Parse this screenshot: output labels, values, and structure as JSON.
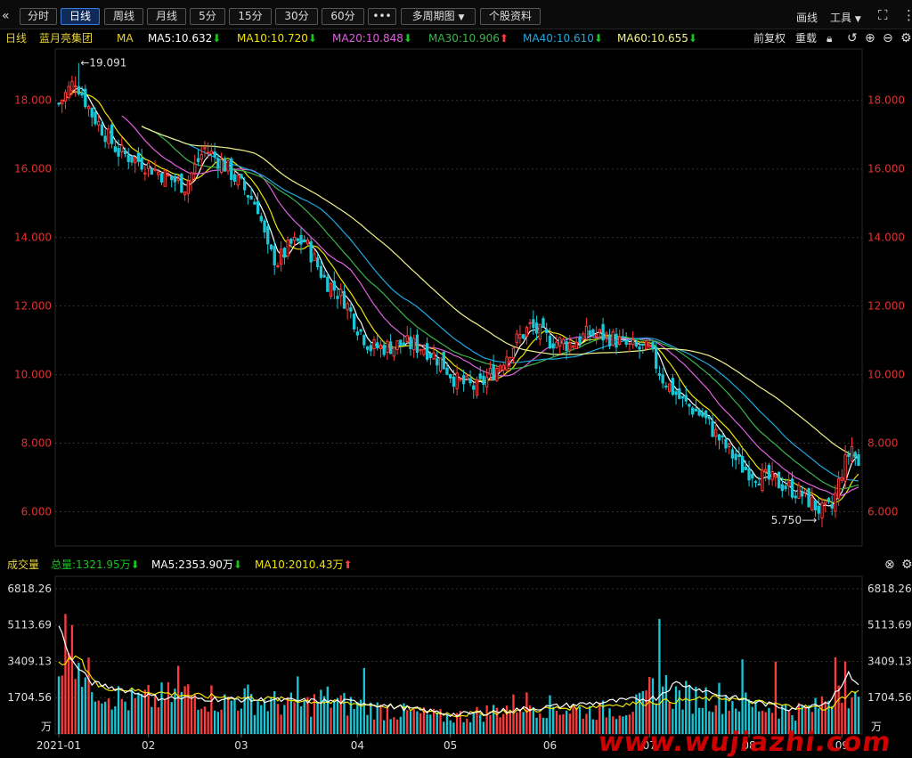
{
  "toolbar": {
    "collapse_icon": "double-chevron-left-icon",
    "tabs": [
      "分时",
      "日线",
      "周线",
      "月线",
      "5分",
      "15分",
      "30分",
      "60分"
    ],
    "active_tab": "日线",
    "more_label": "•••",
    "multi_period": "多周期图",
    "stock_info": "个股资料",
    "draw": "画线",
    "tools": "工具",
    "fullscreen_icon": "fullscreen-icon",
    "more_icon": "vertical-dots-icon"
  },
  "ma_bar": {
    "period": "日线",
    "stock_name": "蓝月亮集团",
    "ma_label": "MA",
    "items": [
      {
        "text": "MA5:10.632",
        "dir": "down",
        "color": "#ffffff"
      },
      {
        "text": "MA10:10.720",
        "dir": "down",
        "color": "#f2e600"
      },
      {
        "text": "MA20:10.848",
        "dir": "down",
        "color": "#e060e0"
      },
      {
        "text": "MA30:10.906",
        "dir": "up",
        "color": "#3bb54a"
      },
      {
        "text": "MA40:10.610",
        "dir": "down",
        "color": "#1fa8e0"
      },
      {
        "text": "MA60:10.655",
        "dir": "down",
        "color": "#f2f28a"
      }
    ],
    "adjust": "前复权",
    "reset": "重载",
    "icons": [
      "lock-icon",
      "undo-icon",
      "zoom-in-icon",
      "zoom-out-icon",
      "settings-icon"
    ]
  },
  "price_axis": {
    "ticks": [
      "18.000",
      "16.000",
      "14.000",
      "12.000",
      "10.000",
      "8.000",
      "6.000"
    ],
    "tick_values": [
      18,
      16,
      14,
      12,
      10,
      8,
      6
    ],
    "y_range": [
      5.0,
      19.5
    ],
    "high_label": "19.091",
    "low_label": "5.750"
  },
  "volume_head": {
    "title": "成交量",
    "total": "总量:1321.95万",
    "total_dir": "down",
    "ma5": "MA5:2353.90万",
    "ma5_dir": "down",
    "ma10": "MA10:2010.43万",
    "ma10_dir": "up",
    "close_icon": "close-circle-icon",
    "settings_icon": "settings-icon"
  },
  "volume_axis": {
    "ticks": [
      "6818.26",
      "5113.69",
      "3409.13",
      "1704.56"
    ],
    "tick_values": [
      6818.26,
      5113.69,
      3409.13,
      1704.56
    ],
    "unit": "万"
  },
  "x_axis": {
    "labels": [
      "2021-01",
      "02",
      "03",
      "04",
      "05",
      "06",
      "07",
      "08",
      "09"
    ],
    "label_index": [
      0,
      27,
      55,
      90,
      118,
      148,
      178,
      208,
      236
    ]
  },
  "colors": {
    "up": "#ff3b3b",
    "down": "#19c8d8",
    "grid": "#333333",
    "axis_text": "#e23030"
  },
  "watermark": "www.wujiazhi.com",
  "chart_data": {
    "type": "candlestick",
    "series_anchors": {
      "close": [
        [
          0,
          17.9
        ],
        [
          5,
          18.6
        ],
        [
          10,
          17.6
        ],
        [
          18,
          16.5
        ],
        [
          25,
          16.2
        ],
        [
          32,
          15.8
        ],
        [
          38,
          15.5
        ],
        [
          44,
          16.6
        ],
        [
          50,
          16.1
        ],
        [
          56,
          15.4
        ],
        [
          60,
          14.9
        ],
        [
          63,
          13.6
        ],
        [
          66,
          13.3
        ],
        [
          70,
          13.8
        ],
        [
          74,
          13.9
        ],
        [
          80,
          12.8
        ],
        [
          86,
          12.2
        ],
        [
          90,
          11.4
        ],
        [
          94,
          10.8
        ],
        [
          98,
          10.8
        ],
        [
          104,
          10.9
        ],
        [
          110,
          10.8
        ],
        [
          115,
          10.4
        ],
        [
          120,
          9.8
        ],
        [
          126,
          9.6
        ],
        [
          132,
          10.2
        ],
        [
          138,
          11.0
        ],
        [
          142,
          11.4
        ],
        [
          148,
          11.0
        ],
        [
          154,
          10.9
        ],
        [
          160,
          11.2
        ],
        [
          166,
          11.1
        ],
        [
          172,
          10.8
        ],
        [
          178,
          10.7
        ],
        [
          182,
          9.9
        ],
        [
          188,
          9.2
        ],
        [
          194,
          8.8
        ],
        [
          200,
          8.0
        ],
        [
          206,
          7.3
        ],
        [
          212,
          7.0
        ],
        [
          218,
          6.8
        ],
        [
          224,
          6.5
        ],
        [
          230,
          6.0
        ],
        [
          233,
          6.1
        ],
        [
          236,
          7.2
        ],
        [
          239,
          7.9
        ],
        [
          241,
          7.3
        ]
      ],
      "volume": [
        [
          0,
          3400
        ],
        [
          4,
          5200
        ],
        [
          8,
          2600
        ],
        [
          14,
          2100
        ],
        [
          20,
          1500
        ],
        [
          26,
          1600
        ],
        [
          32,
          1700
        ],
        [
          38,
          1900
        ],
        [
          44,
          1800
        ],
        [
          50,
          1500
        ],
        [
          56,
          1700
        ],
        [
          62,
          1500
        ],
        [
          68,
          1400
        ],
        [
          74,
          1300
        ],
        [
          80,
          1700
        ],
        [
          86,
          1400
        ],
        [
          92,
          1300
        ],
        [
          98,
          1100
        ],
        [
          104,
          1000
        ],
        [
          110,
          900
        ],
        [
          116,
          800
        ],
        [
          122,
          850
        ],
        [
          128,
          1000
        ],
        [
          134,
          1200
        ],
        [
          140,
          1500
        ],
        [
          146,
          1300
        ],
        [
          152,
          1200
        ],
        [
          158,
          1100
        ],
        [
          164,
          1100
        ],
        [
          170,
          1200
        ],
        [
          176,
          1400
        ],
        [
          180,
          2500
        ],
        [
          186,
          1800
        ],
        [
          192,
          1700
        ],
        [
          198,
          1800
        ],
        [
          204,
          1500
        ],
        [
          210,
          1300
        ],
        [
          216,
          1200
        ],
        [
          222,
          1100
        ],
        [
          228,
          1200
        ],
        [
          232,
          1800
        ],
        [
          236,
          2600
        ],
        [
          241,
          1322
        ]
      ],
      "volume_spikes": [
        [
          4,
          5113
        ],
        [
          36,
          3200
        ],
        [
          72,
          2700
        ],
        [
          92,
          3100
        ],
        [
          181,
          5400
        ],
        [
          206,
          3500
        ],
        [
          216,
          3400
        ],
        [
          234,
          3600
        ],
        [
          237,
          3400
        ]
      ],
      "ma5_volume": [
        [
          0,
          5100
        ],
        [
          4,
          3400
        ],
        [
          10,
          2400
        ],
        [
          30,
          1700
        ],
        [
          60,
          1600
        ],
        [
          90,
          1500
        ],
        [
          120,
          900
        ],
        [
          150,
          1300
        ],
        [
          180,
          1700
        ],
        [
          186,
          2400
        ],
        [
          200,
          1800
        ],
        [
          220,
          1200
        ],
        [
          232,
          1500
        ],
        [
          238,
          2800
        ],
        [
          241,
          2354
        ]
      ],
      "ma10_volume": [
        [
          0,
          3300
        ],
        [
          6,
          3600
        ],
        [
          12,
          2200
        ],
        [
          40,
          1800
        ],
        [
          70,
          1600
        ],
        [
          100,
          1300
        ],
        [
          120,
          900
        ],
        [
          150,
          1200
        ],
        [
          180,
          1500
        ],
        [
          200,
          1700
        ],
        [
          220,
          1300
        ],
        [
          232,
          1200
        ],
        [
          238,
          1900
        ],
        [
          241,
          2010
        ]
      ]
    },
    "ma_periods": [
      5,
      10,
      20,
      30,
      40,
      60
    ],
    "bar_count": 242,
    "high": {
      "value": 19.091,
      "index": 6
    },
    "low": {
      "value": 5.75,
      "index": 229
    }
  }
}
